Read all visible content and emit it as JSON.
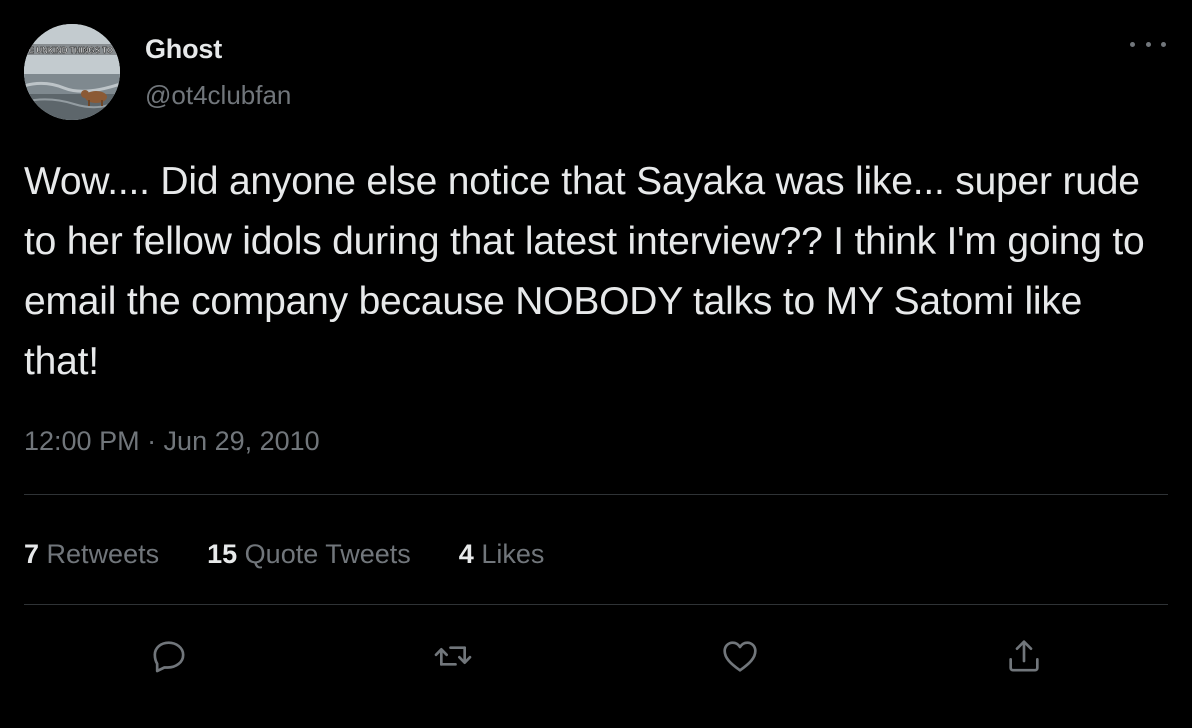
{
  "user": {
    "display_name": "Ghost",
    "handle": "@ot4clubfan",
    "avatar_caption": "SAVE UNKIND THINGS TO SAY"
  },
  "more_icon": "more-horizontal-icon",
  "tweet": {
    "text": "Wow.... Did anyone else notice that Sayaka was like... super rude to her fellow idols during that latest interview?? I think I'm going to email the company because NOBODY talks to MY Satomi like that!",
    "timestamp": "12:00 PM · Jun 29, 2010"
  },
  "stats": {
    "retweets_count": "7",
    "retweets_label": "Retweets",
    "quotes_count": "15",
    "quotes_label": "Quote Tweets",
    "likes_count": "4",
    "likes_label": "Likes"
  },
  "actions": [
    "reply-icon",
    "retweet-icon",
    "like-icon",
    "share-icon"
  ],
  "colors": {
    "background": "#000000",
    "primary_text": "#e7e9ea",
    "secondary_text": "#71767b",
    "divider": "#2f3336"
  }
}
